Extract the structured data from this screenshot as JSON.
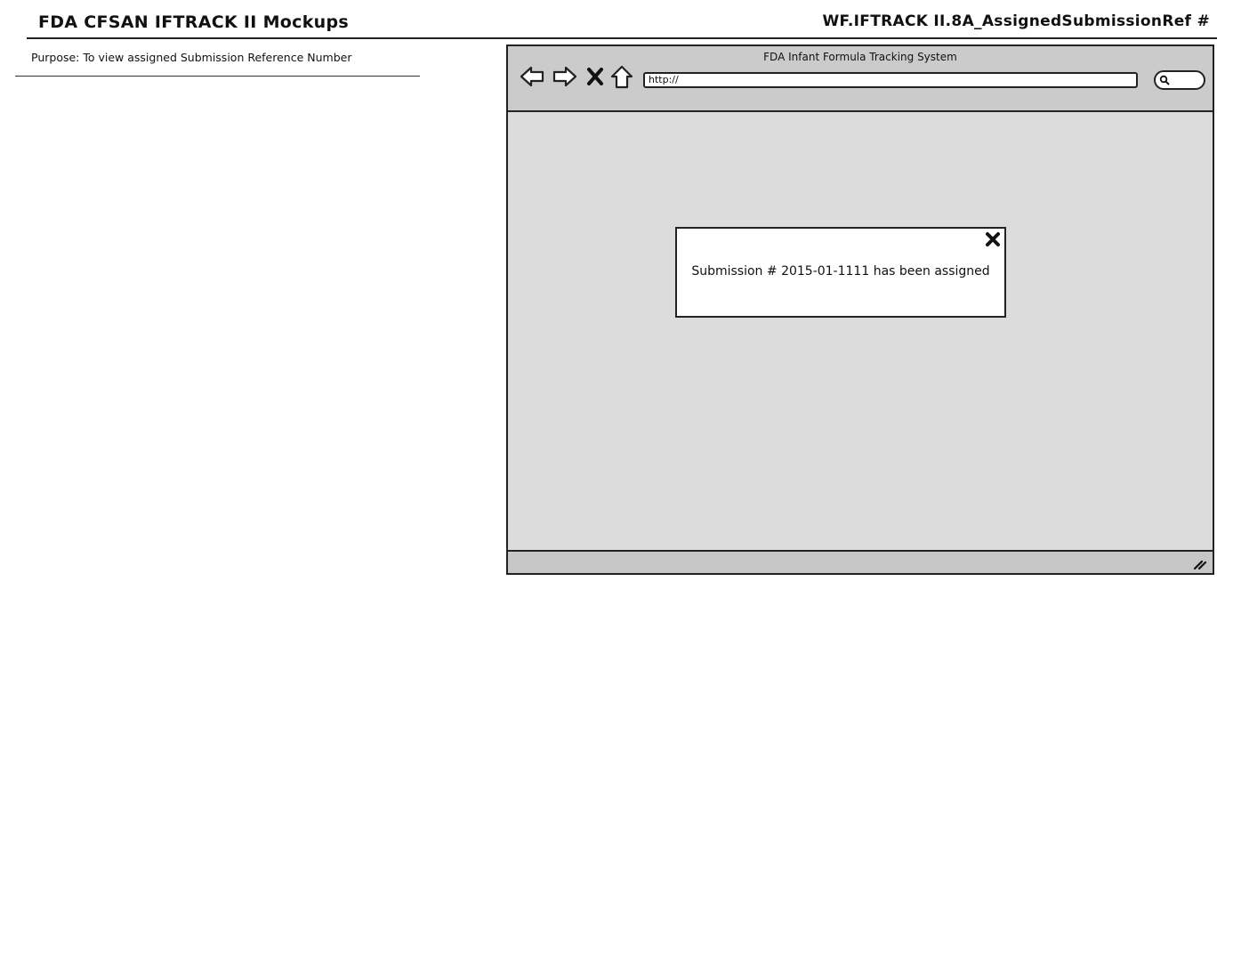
{
  "header": {
    "title": "FDA CFSAN IFTRACK II Mockups",
    "reference": "WF.IFTRACK II.8A_AssignedSubmissionRef #"
  },
  "purpose": {
    "text": "Purpose: To view assigned Submission Reference Number"
  },
  "browser": {
    "window_title": "FDA Infant Formula Tracking System",
    "url": "http://",
    "nav_icons": [
      "back-arrow-icon",
      "forward-arrow-icon",
      "stop-icon",
      "home-icon"
    ],
    "search_icon": "search-icon"
  },
  "dialog": {
    "message": "Submission # 2015-01-1111 has been assigned",
    "close_icon": "close-icon"
  }
}
